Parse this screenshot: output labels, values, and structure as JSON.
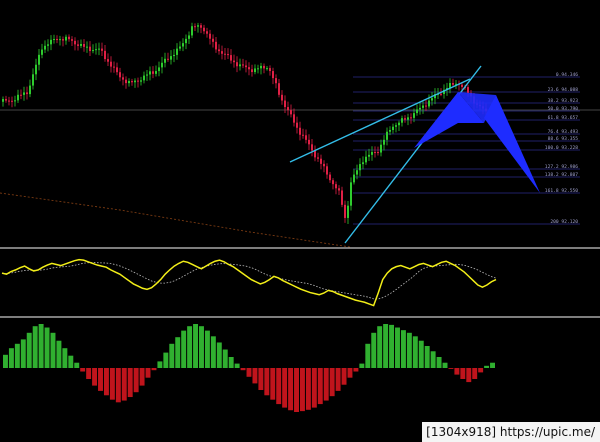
{
  "colors": {
    "background": "#000000",
    "bull_candle": "#2ecc2e",
    "bear_candle": "#e02045",
    "trendline": "#33bde8",
    "harmonic_pattern": "#1e2cff",
    "fib_line": "#2a2c8c",
    "oscillator": "#f2ee18",
    "signal_line": "#bbbbbb",
    "hist_positive": "#30b030",
    "hist_negative": "#c0141c",
    "pane_divider": "#c8c8c8",
    "channel_line": "#7a3a12"
  },
  "fib_levels": [
    {
      "label": "0.94.346"
    },
    {
      "label": "23.6 94.088"
    },
    {
      "label": "38.2 93.923"
    },
    {
      "label": "50.0 93.790"
    },
    {
      "label": "61.8 93.657"
    },
    {
      "label": "76.4 93.493"
    },
    {
      "label": "88.6 93.355"
    },
    {
      "label": "100.0 93.228"
    },
    {
      "label": "127.2 92.986"
    },
    {
      "label": "138.2 92.807"
    },
    {
      "label": "161.8 92.550"
    },
    {
      "label": "200 92.120"
    }
  ],
  "oscillator_series": [
    0.72,
    0.7,
    0.75,
    0.78,
    0.82,
    0.85,
    0.8,
    0.76,
    0.78,
    0.83,
    0.87,
    0.9,
    0.88,
    0.86,
    0.89,
    0.92,
    0.95,
    0.97,
    0.96,
    0.93,
    0.9,
    0.87,
    0.85,
    0.83,
    0.78,
    0.74,
    0.7,
    0.64,
    0.58,
    0.52,
    0.48,
    0.44,
    0.42,
    0.45,
    0.52,
    0.6,
    0.7,
    0.78,
    0.85,
    0.9,
    0.94,
    0.92,
    0.88,
    0.84,
    0.8,
    0.85,
    0.9,
    0.94,
    0.96,
    0.93,
    0.88,
    0.84,
    0.78,
    0.72,
    0.66,
    0.6,
    0.56,
    0.52,
    0.55,
    0.6,
    0.66,
    0.63,
    0.58,
    0.54,
    0.5,
    0.46,
    0.42,
    0.39,
    0.36,
    0.34,
    0.32,
    0.35,
    0.4,
    0.38,
    0.34,
    0.31,
    0.28,
    0.25,
    0.22,
    0.2,
    0.18,
    0.15,
    0.12,
    0.35,
    0.6,
    0.72,
    0.8,
    0.84,
    0.86,
    0.83,
    0.8,
    0.84,
    0.88,
    0.9,
    0.87,
    0.84,
    0.88,
    0.92,
    0.94,
    0.9,
    0.86,
    0.8,
    0.74,
    0.66,
    0.58,
    0.5,
    0.46,
    0.5,
    0.56,
    0.6
  ],
  "histogram_series": [
    0.3,
    0.45,
    0.55,
    0.65,
    0.8,
    0.95,
    1.0,
    0.92,
    0.8,
    0.62,
    0.45,
    0.28,
    0.12,
    -0.08,
    -0.25,
    -0.4,
    -0.52,
    -0.62,
    -0.72,
    -0.78,
    -0.74,
    -0.66,
    -0.55,
    -0.4,
    -0.22,
    -0.05,
    0.15,
    0.35,
    0.55,
    0.7,
    0.85,
    0.95,
    1.0,
    0.95,
    0.85,
    0.72,
    0.58,
    0.42,
    0.25,
    0.1,
    -0.05,
    -0.2,
    -0.35,
    -0.5,
    -0.62,
    -0.72,
    -0.82,
    -0.9,
    -0.96,
    -1.0,
    -0.98,
    -0.95,
    -0.9,
    -0.82,
    -0.74,
    -0.64,
    -0.52,
    -0.38,
    -0.22,
    -0.08,
    0.1,
    0.55,
    0.8,
    0.95,
    1.0,
    0.98,
    0.92,
    0.86,
    0.8,
    0.72,
    0.62,
    0.5,
    0.38,
    0.25,
    0.12,
    -0.02,
    -0.15,
    -0.25,
    -0.32,
    -0.25,
    -0.1,
    0.05,
    0.12
  ]
}
